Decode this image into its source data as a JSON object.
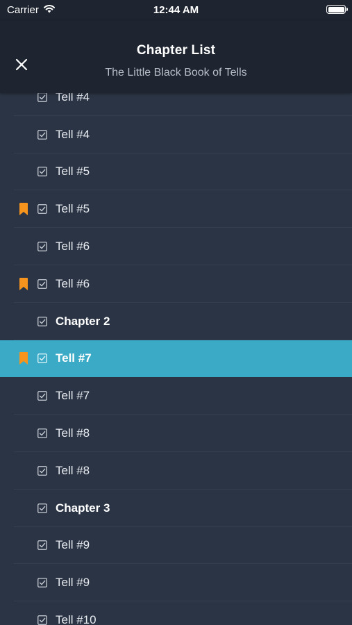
{
  "status_bar": {
    "carrier": "Carrier",
    "time": "12:44 AM",
    "battery_level": 1.0
  },
  "header": {
    "title": "Chapter List",
    "subtitle": "The Little Black Book of Tells"
  },
  "colors": {
    "header_bg": "#1f2530",
    "list_bg": "#2b3444",
    "selected_bg": "#3aaac7",
    "bookmark": "#f7941d"
  },
  "chapters": [
    {
      "label": "Tell #4",
      "type": "tell",
      "bookmarked": false,
      "checked": true,
      "selected": false
    },
    {
      "label": "Tell #4",
      "type": "tell",
      "bookmarked": false,
      "checked": true,
      "selected": false
    },
    {
      "label": "Tell #5",
      "type": "tell",
      "bookmarked": false,
      "checked": true,
      "selected": false
    },
    {
      "label": "Tell #5",
      "type": "tell",
      "bookmarked": true,
      "checked": true,
      "selected": false
    },
    {
      "label": "Tell #6",
      "type": "tell",
      "bookmarked": false,
      "checked": true,
      "selected": false
    },
    {
      "label": "Tell #6",
      "type": "tell",
      "bookmarked": true,
      "checked": true,
      "selected": false
    },
    {
      "label": "Chapter 2",
      "type": "chapter",
      "bookmarked": false,
      "checked": true,
      "selected": false
    },
    {
      "label": "Tell #7",
      "type": "tell",
      "bookmarked": true,
      "checked": true,
      "selected": true
    },
    {
      "label": "Tell #7",
      "type": "tell",
      "bookmarked": false,
      "checked": true,
      "selected": false
    },
    {
      "label": "Tell #8",
      "type": "tell",
      "bookmarked": false,
      "checked": true,
      "selected": false
    },
    {
      "label": "Tell #8",
      "type": "tell",
      "bookmarked": false,
      "checked": true,
      "selected": false
    },
    {
      "label": "Chapter 3",
      "type": "chapter",
      "bookmarked": false,
      "checked": true,
      "selected": false
    },
    {
      "label": "Tell #9",
      "type": "tell",
      "bookmarked": false,
      "checked": true,
      "selected": false
    },
    {
      "label": "Tell #9",
      "type": "tell",
      "bookmarked": false,
      "checked": true,
      "selected": false
    },
    {
      "label": "Tell #10",
      "type": "tell",
      "bookmarked": false,
      "checked": true,
      "selected": false
    }
  ]
}
